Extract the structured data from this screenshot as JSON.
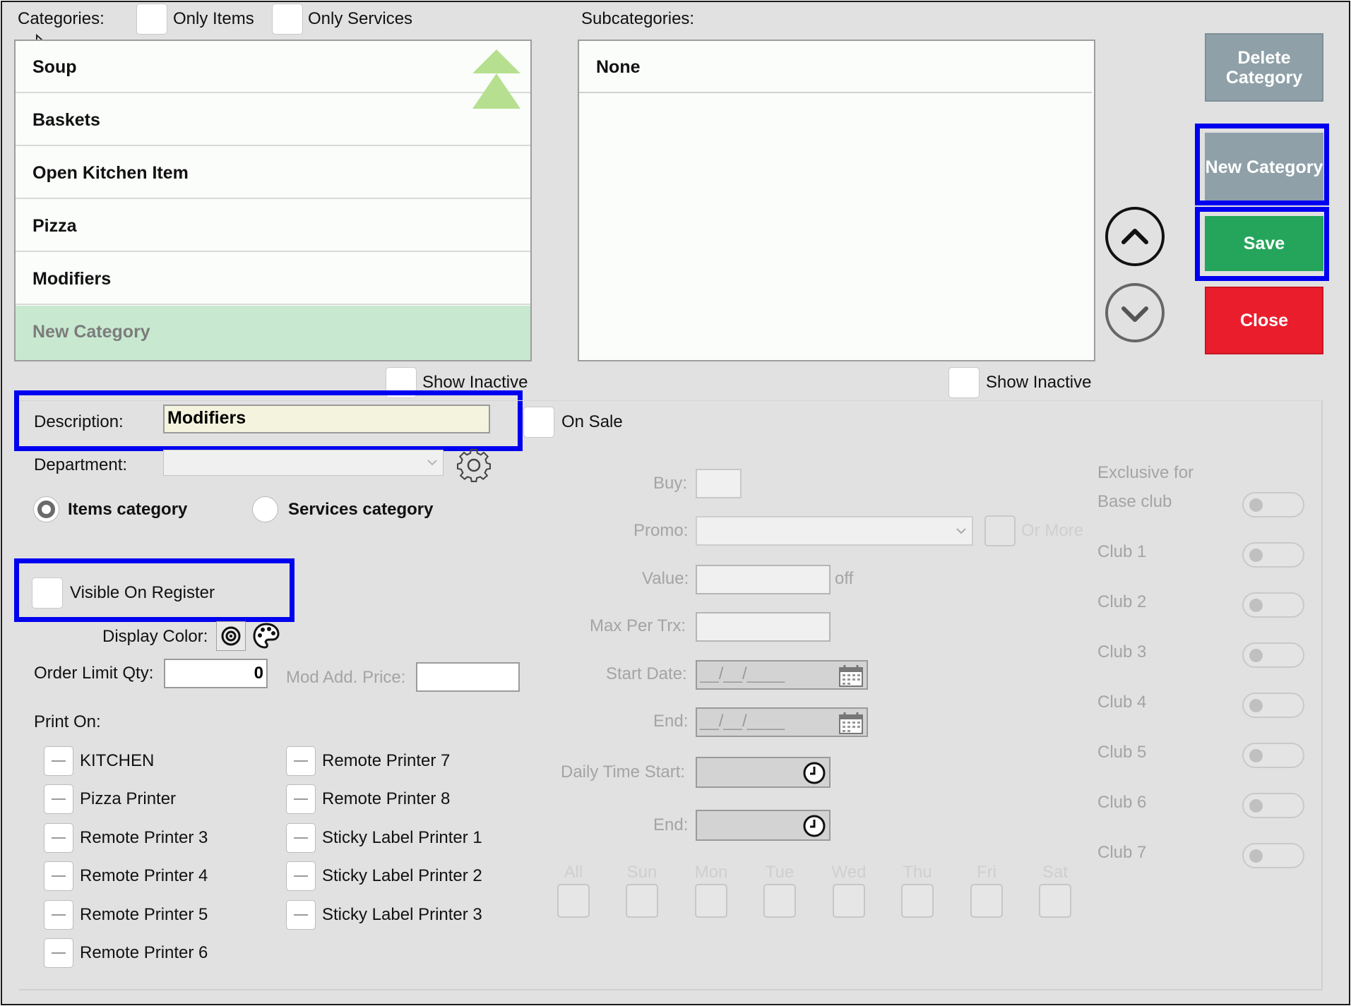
{
  "categories_header": {
    "label": "Categories:",
    "only_items": "Only Items",
    "only_services": "Only Services"
  },
  "categories": [
    {
      "label": "Soup"
    },
    {
      "label": "Baskets"
    },
    {
      "label": "Open Kitchen Item"
    },
    {
      "label": "Pizza"
    },
    {
      "label": "Modifiers"
    },
    {
      "label": "New Category",
      "selected": true
    }
  ],
  "subcategories": {
    "label": "Subcategories:",
    "items": [
      {
        "label": "None"
      }
    ]
  },
  "show_inactive": "Show Inactive",
  "buttons": {
    "delete_category": "Delete Category",
    "new_category": "New Category",
    "save": "Save",
    "close": "Close"
  },
  "description": {
    "label": "Description:",
    "value": "Modifiers"
  },
  "on_sale": "On Sale",
  "department": {
    "label": "Department:",
    "value": ""
  },
  "category_type": {
    "items": "Items category",
    "services": "Services category",
    "selected": "items"
  },
  "visible_on_register": "Visible On Register",
  "display_color": "Display Color:",
  "order_limit": {
    "label": "Order Limit Qty:",
    "value": "0"
  },
  "mod_add_price": {
    "label": "Mod Add. Price:",
    "value": ""
  },
  "print_on": {
    "label": "Print On:",
    "left": [
      "KITCHEN",
      "Pizza Printer",
      "Remote Printer 3",
      "Remote Printer 4",
      "Remote Printer 5",
      "Remote Printer 6"
    ],
    "right": [
      "Remote Printer 7",
      "Remote Printer 8",
      "Sticky Label Printer 1",
      "Sticky Label Printer 2",
      "Sticky Label Printer 3"
    ]
  },
  "promo": {
    "buy": "Buy:",
    "promo": "Promo:",
    "or_more": "Or More",
    "value": "Value:",
    "off": "off",
    "max_per_trx": "Max Per Trx:",
    "start_date": "Start Date:",
    "end": "End:",
    "date_placeholder": "__/__/____",
    "daily_time_start": "Daily Time Start:",
    "end2": "End:"
  },
  "days": [
    "All",
    "Sun",
    "Mon",
    "Tue",
    "Wed",
    "Thu",
    "Fri",
    "Sat"
  ],
  "exclusive": {
    "line1": "Exclusive for",
    "line2": "Base club",
    "clubs": [
      "Club 1",
      "Club 2",
      "Club 3",
      "Club 4",
      "Club 5",
      "Club 6",
      "Club 7"
    ]
  },
  "colors": {
    "save": "#25a55c",
    "close": "#ea1d2c",
    "gray_button": "#8fa0a8",
    "highlight": "#0000f0",
    "selected_row": "#c8e9cf"
  }
}
